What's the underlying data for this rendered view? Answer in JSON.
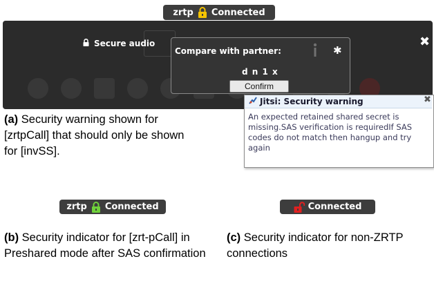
{
  "figure_a": {
    "indicator": {
      "label": "zrtp",
      "status": "Connected",
      "lock_icon": "lock-icon",
      "lock_color": "#f5c400"
    },
    "call_window": {
      "secure_audio_label": "Secure audio",
      "lock_icon": "lock-icon",
      "close_icon": "close-icon"
    },
    "sas_popup": {
      "title": "Compare with partner:",
      "code": "d n 1 x",
      "confirm_label": "Confirm",
      "info_icon": "info-icon",
      "gear_icon": "gear-icon"
    },
    "warning": {
      "title": "Jitsi: Security warning",
      "message": "An expected retained shared secret is missing.SAS verification is requiredIf SAS codes do not match then hangup and try again",
      "close_icon": "close-icon",
      "app_icon": "jitsi-icon"
    },
    "caption": {
      "label": "(a)",
      "text": "Security warning shown for [zrtpCall] that should only be shown for [invSS]."
    }
  },
  "figure_b": {
    "indicator": {
      "label": "zrtp",
      "status": "Connected",
      "lock_icon": "lock-icon",
      "lock_color": "#6fd13a"
    },
    "caption": {
      "label": "(b)",
      "text": "Security indicator for [zrt-pCall] in Preshared mode after SAS confirmation"
    }
  },
  "figure_c": {
    "indicator": {
      "status": "Connected",
      "lock_icon": "unlocked-icon",
      "lock_color": "#e02020"
    },
    "caption": {
      "label": "(c)",
      "text": "Security indicator for non-ZRTP connections"
    }
  }
}
